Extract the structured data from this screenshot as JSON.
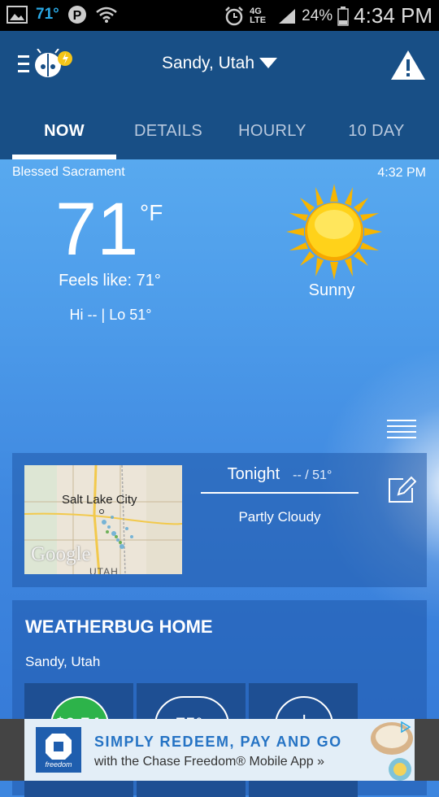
{
  "status_bar": {
    "temp": "71°",
    "battery": "24%",
    "network": "4G LTE",
    "time": "4:34 PM"
  },
  "header": {
    "location": "Sandy, Utah",
    "tabs": [
      "NOW",
      "DETAILS",
      "HOURLY",
      "10 DAY"
    ],
    "active_tab": "NOW"
  },
  "now": {
    "station": "Blessed Sacrament",
    "time": "4:32 PM",
    "temperature": "71",
    "unit": "°F",
    "feels_like": "Feels like: 71°",
    "hi_lo": "Hi -- | Lo 51°",
    "condition": "Sunny"
  },
  "tonight_card": {
    "map_city": "Salt Lake City",
    "map_brand": "Google",
    "map_state": "UTAH",
    "title": "Tonight",
    "temp": "-- / 51°",
    "condition": "Partly Cloudy"
  },
  "home_card": {
    "title": "WEATHERBUG HOME",
    "location": "Sandy, Utah",
    "tiles": [
      {
        "label": "$0.54",
        "color": "#2db34a"
      },
      {
        "label": "75°",
        "color": "#1e4f93"
      },
      {
        "label": "+",
        "color": "#1e4f93"
      }
    ]
  },
  "ad": {
    "line1": "SIMPLY REDEEM, PAY AND GO",
    "line2": "with the Chase Freedom® Mobile App »",
    "brand": "freedom"
  }
}
